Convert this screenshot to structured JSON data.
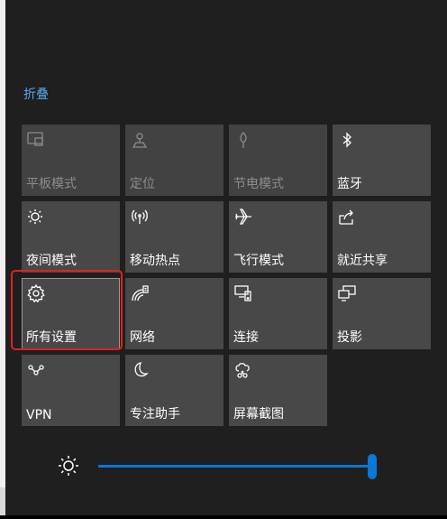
{
  "collapse_label": "折叠",
  "tiles": [
    {
      "label": "平板模式",
      "icon": "tablet-mode-icon",
      "state": "disabled"
    },
    {
      "label": "定位",
      "icon": "location-icon",
      "state": "disabled"
    },
    {
      "label": "节电模式",
      "icon": "battery-saver-icon",
      "state": "disabled"
    },
    {
      "label": "蓝牙",
      "icon": "bluetooth-icon",
      "state": "off"
    },
    {
      "label": "夜间模式",
      "icon": "night-light-icon",
      "state": "off"
    },
    {
      "label": "移动热点",
      "icon": "mobile-hotspot-icon",
      "state": "off"
    },
    {
      "label": "飞行模式",
      "icon": "airplane-icon",
      "state": "off"
    },
    {
      "label": "就近共享",
      "icon": "nearby-share-icon",
      "state": "off"
    },
    {
      "label": "所有设置",
      "icon": "settings-gear-icon",
      "state": "off"
    },
    {
      "label": "网络",
      "icon": "network-icon",
      "state": "off"
    },
    {
      "label": "连接",
      "icon": "connect-icon",
      "state": "off"
    },
    {
      "label": "投影",
      "icon": "project-icon",
      "state": "off"
    },
    {
      "label": "VPN",
      "icon": "vpn-icon",
      "state": "off"
    },
    {
      "label": "专注助手",
      "icon": "focus-assist-icon",
      "state": "off"
    },
    {
      "label": "屏幕截图",
      "icon": "screen-snip-icon",
      "state": "off"
    }
  ],
  "brightness": {
    "icon": "brightness-icon",
    "level": 1.0
  },
  "colors": {
    "accent": "#0a78d7",
    "link": "#5aa7e8",
    "highlight": "#e02020",
    "tile": "#484848"
  }
}
